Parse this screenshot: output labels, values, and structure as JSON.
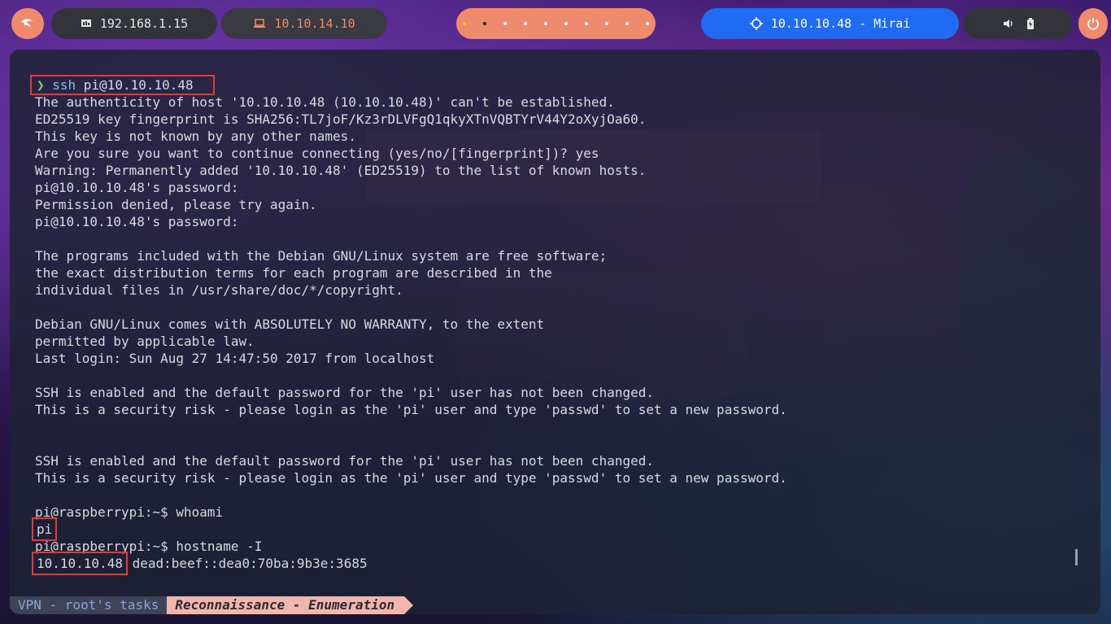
{
  "topbar": {
    "host_ip": "192.168.1.15",
    "vpn_ip": "10.10.14.10",
    "target": "10.10.10.48 - Mirai",
    "workspaces_count_text": "",
    "accent_color": "#f08a6c",
    "target_color": "#1f6bf2"
  },
  "terminal": {
    "lines": [
      {
        "prompt": "❯",
        "cmd": "ssh",
        "arg": " pi@10.10.10.48"
      },
      "The authenticity of host '10.10.10.48 (10.10.10.48)' can't be established.",
      "ED25519 key fingerprint is SHA256:TL7joF/Kz3rDLVFgQ1qkyXTnVQBTYrV44Y2oXyjOa60.",
      "This key is not known by any other names.",
      "Are you sure you want to continue connecting (yes/no/[fingerprint])? yes",
      "Warning: Permanently added '10.10.10.48' (ED25519) to the list of known hosts.",
      "pi@10.10.10.48's password:",
      "Permission denied, please try again.",
      "pi@10.10.10.48's password:",
      "",
      "The programs included with the Debian GNU/Linux system are free software;",
      "the exact distribution terms for each program are described in the",
      "individual files in /usr/share/doc/*/copyright.",
      "",
      "Debian GNU/Linux comes with ABSOLUTELY NO WARRANTY, to the extent",
      "permitted by applicable law.",
      "Last login: Sun Aug 27 14:47:50 2017 from localhost",
      "",
      "SSH is enabled and the default password for the 'pi' user has not been changed.",
      "This is a security risk - please login as the 'pi' user and type 'passwd' to set a new password.",
      "",
      "",
      "SSH is enabled and the default password for the 'pi' user has not been changed.",
      "This is a security risk - please login as the 'pi' user and type 'passwd' to set a new password.",
      "",
      "pi@raspberrypi:~$ whoami",
      "pi",
      "pi@raspberrypi:~$ hostname -I",
      {
        "ip": "10.10.10.48",
        "rest": " dead:beef::dea0:70ba:9b3e:3685"
      }
    ]
  },
  "statusline": {
    "session": "VPN - root's tasks",
    "window": "Reconnaissance - Enumeration"
  }
}
